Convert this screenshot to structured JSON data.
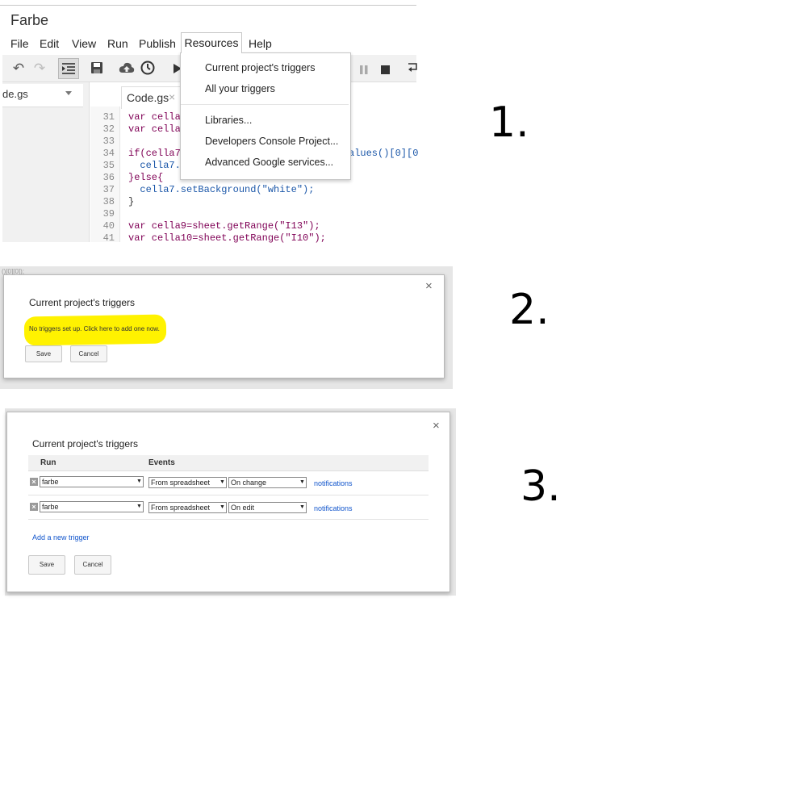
{
  "step_numbers": [
    "1.",
    "2.",
    "3."
  ],
  "editor": {
    "app_title": "Farbe",
    "menu": {
      "file": "File",
      "edit": "Edit",
      "view": "View",
      "run": "Run",
      "publish": "Publish",
      "resources": "Resources",
      "help": "Help"
    },
    "toolbar_icons": [
      "undo-icon",
      "redo-icon",
      "indent-icon",
      "save-icon",
      "cloud-upload-icon",
      "clock-icon",
      "play-icon",
      "pause-icon",
      "stop-icon",
      "wrap-icon"
    ],
    "file_selector": "de.gs",
    "tab_label": "Code.gs",
    "tab_close": "×",
    "line_numbers": [
      "31",
      "32",
      "33",
      "34",
      "35",
      "36",
      "37",
      "38",
      "39",
      "40",
      "41"
    ],
    "code_lines": [
      "var cella",
      "var cella",
      "",
      "if(cella7",
      "  cella7.",
      "}else{",
      "  cella7.setBackground(\"white\");",
      "}",
      "",
      "var cella9=sheet.getRange(\"I13\");",
      "var cella10=sheet.getRange(\"I10\");"
    ],
    "code_overflow": "alues()[0][0"
  },
  "resources_dropdown": {
    "items": [
      "Current project's triggers",
      "All your triggers",
      "Libraries...",
      "Developers Console Project...",
      "Advanced Google services..."
    ]
  },
  "dialog_empty": {
    "title": "Current project's triggers",
    "message": "No triggers set up. Click here to add one now.",
    "save": "Save",
    "cancel": "Cancel",
    "close": "×",
    "faint_text": "()[0][0]);"
  },
  "dialog_triggers": {
    "title": "Current project's triggers",
    "columns": {
      "run": "Run",
      "events": "Events"
    },
    "rows": [
      {
        "function": "farbe",
        "source": "From spreadsheet",
        "event": "On change",
        "link": "notifications"
      },
      {
        "function": "farbe",
        "source": "From spreadsheet",
        "event": "On edit",
        "link": "notifications"
      }
    ],
    "add_trigger": "Add a new trigger",
    "save": "Save",
    "cancel": "Cancel",
    "close": "×",
    "delete_glyph": "×",
    "dropdown_arrow": "▼"
  },
  "colors": {
    "highlight": "#fff200",
    "link": "#1155cc"
  }
}
